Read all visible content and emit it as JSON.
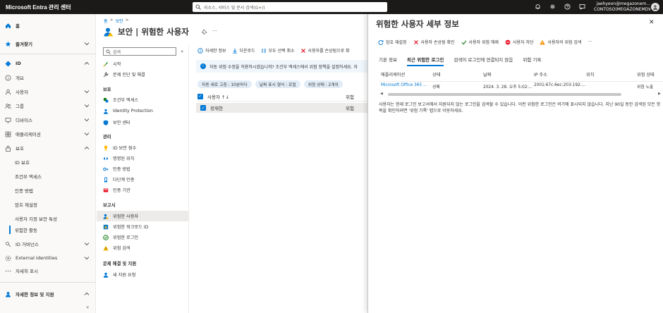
{
  "topbar": {
    "brand": "Microsoft Entra 관리 센터",
    "search_placeholder": "리소스, 서비스 및 문서 검색(G+/)",
    "account_name": "jaehyeon@megazonem...",
    "account_org": "CONTOSO(MEGAZONEMDW..."
  },
  "leftnav": {
    "items": [
      {
        "label": "홈"
      },
      {
        "label": "즐겨찾기"
      },
      {
        "label": "ID"
      },
      {
        "label": "개요"
      },
      {
        "label": "사용자"
      },
      {
        "label": "그룹"
      },
      {
        "label": "디바이스"
      },
      {
        "label": "애플리케이션"
      },
      {
        "label": "보호"
      },
      {
        "label": "ID 보호"
      },
      {
        "label": "조건부 액세스"
      },
      {
        "label": "인증 방법"
      },
      {
        "label": "암호 재설정"
      },
      {
        "label": "사용자 지정 보안 특성"
      },
      {
        "label": "위험한 활동"
      },
      {
        "label": "ID 거버넌스"
      },
      {
        "label": "External Identities"
      },
      {
        "label": "자세히 표시"
      },
      {
        "label": "자세한 정보 및 지원"
      }
    ]
  },
  "blade": {
    "breadcrumb": [
      "홈",
      ">",
      "보안",
      ">"
    ],
    "title": "보안 | 위험한 사용자",
    "search_placeholder": "검색",
    "sections": {
      "protect": "보호",
      "manage": "관리",
      "report": "보고서",
      "troubleshoot": "문제 해결 및 지원"
    },
    "items_top": [
      "시작",
      "문제 진단 및 해결"
    ],
    "items_protect": [
      "조건부 액세스",
      "Identity Protection",
      "보안 센터"
    ],
    "items_manage": [
      "ID 보안 점수",
      "명명된 위치",
      "인증 방법",
      "다단계 인증",
      "인증 기관"
    ],
    "items_report": [
      "위험한 사용자",
      "위험한 워크로드 ID",
      "위험한 로그인",
      "위험 검색"
    ],
    "items_support": [
      "새 지원 요청"
    ]
  },
  "content": {
    "toolbar": [
      "자세한 정보",
      "다운로드",
      "모두 선택 취소",
      "사용자를 손상됨으로 확"
    ],
    "info": "자동 위험 수정을 허용하시겠습니까? 조건부 액세스에서 위험 정책을 설정하세요. 자",
    "pills": [
      "자동 새로 고침 : 10분마다",
      "날짜 표시 형식 : 로컬",
      "위험 상태 : 2개의"
    ],
    "table": {
      "col_user": "사용자 ↑↓",
      "col_risk": "위험",
      "rows": [
        {
          "user": "정재현",
          "risk": "위험"
        }
      ]
    }
  },
  "panel": {
    "title": "위험한 사용자 세부 정보",
    "toolbar": [
      "암호 재설정",
      "사용자 손상됨 확인",
      "사용자 위험 해제",
      "사용자 차단",
      "사용자의 위험 검색",
      "···"
    ],
    "tabs": [
      "기본 정보",
      "최근 위험한 로그인",
      "검색이 로그인에 연결되지 않음",
      "위험 기록"
    ],
    "table": {
      "headers": [
        "애플리케이션",
        "상태",
        "날짜",
        "IP 주소",
        "위치",
        "위험 상태"
      ],
      "rows": [
        {
          "app": "Microsoft Office 365 ...",
          "status": "성패",
          "date": "2024. 3. 28. 오후 5:02:...",
          "ip": "2001:67c:6ec:203:192:...",
          "location": "",
          "risk": "위험 노출"
        }
      ]
    },
    "note": "사용자는 현재 로그인 보고서에서 지원되지 않는 로그인을 검색할 수 있습니다. 이런 위험한 로그인은 여기에 표시되지 않습니다. 지난 90일 동안 검색된 모든 항목을 확인하려면 '위험 기록' 탭으로 이동하세요."
  },
  "colors": {
    "accent": "#0078d4",
    "topbar": "#1b1a19",
    "selected_bg": "#edebe9"
  }
}
